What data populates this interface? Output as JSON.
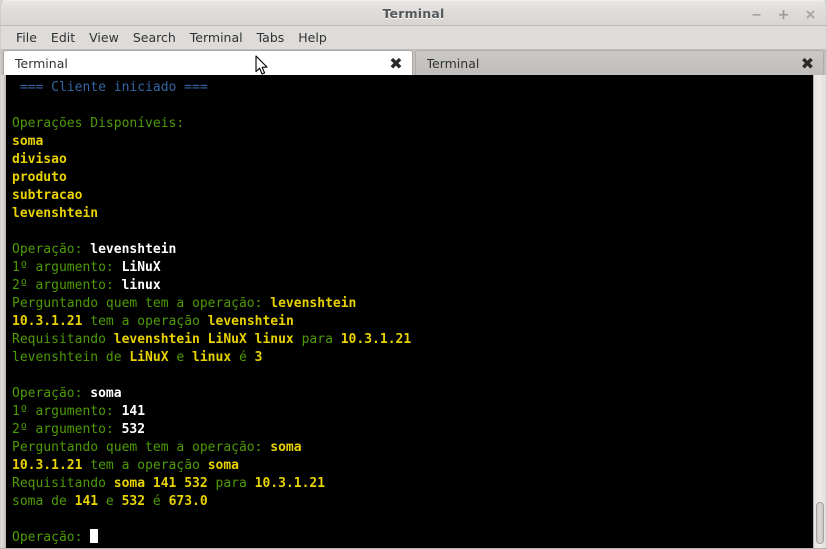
{
  "window": {
    "title": "Terminal",
    "controls": [
      {
        "name": "minimize-button",
        "glyph": "minimize"
      },
      {
        "name": "maximize-button",
        "glyph": "maximize"
      },
      {
        "name": "close-button",
        "glyph": "close"
      }
    ]
  },
  "menubar": {
    "items": [
      {
        "label": "File"
      },
      {
        "label": "Edit"
      },
      {
        "label": "View"
      },
      {
        "label": "Search"
      },
      {
        "label": "Terminal"
      },
      {
        "label": "Tabs"
      },
      {
        "label": "Help"
      }
    ]
  },
  "tabs": [
    {
      "label": "Terminal",
      "active": true,
      "close_glyph": "✖"
    },
    {
      "label": "Terminal",
      "active": false,
      "close_glyph": "✖"
    }
  ],
  "terminal": {
    "colors": {
      "background": "#000000",
      "green": "#4e9a06",
      "yellow_bold": "#e8d200",
      "white_bold": "#ffffff",
      "blue": "#3465a4"
    },
    "lines": [
      {
        "segments": [
          {
            "text": " === Cliente iniciado ===",
            "style": "blue"
          }
        ]
      },
      {
        "segments": []
      },
      {
        "segments": [
          {
            "text": "Operações Disponíveis:",
            "style": "green"
          }
        ]
      },
      {
        "segments": [
          {
            "text": "soma",
            "style": "ybold"
          }
        ]
      },
      {
        "segments": [
          {
            "text": "divisao",
            "style": "ybold"
          }
        ]
      },
      {
        "segments": [
          {
            "text": "produto",
            "style": "ybold"
          }
        ]
      },
      {
        "segments": [
          {
            "text": "subtracao",
            "style": "ybold"
          }
        ]
      },
      {
        "segments": [
          {
            "text": "levenshtein",
            "style": "ybold"
          }
        ]
      },
      {
        "segments": []
      },
      {
        "segments": [
          {
            "text": "Operação: ",
            "style": "green"
          },
          {
            "text": "levenshtein",
            "style": "white"
          }
        ]
      },
      {
        "segments": [
          {
            "text": "1º argumento: ",
            "style": "green"
          },
          {
            "text": "LiNuX",
            "style": "white"
          }
        ]
      },
      {
        "segments": [
          {
            "text": "2º argumento: ",
            "style": "green"
          },
          {
            "text": "linux",
            "style": "white"
          }
        ]
      },
      {
        "segments": [
          {
            "text": "Perguntando quem tem a operação: ",
            "style": "green"
          },
          {
            "text": "levenshtein",
            "style": "ybold"
          }
        ]
      },
      {
        "segments": [
          {
            "text": "10.3.1.21",
            "style": "ybold"
          },
          {
            "text": " tem a operação ",
            "style": "green"
          },
          {
            "text": "levenshtein",
            "style": "ybold"
          }
        ]
      },
      {
        "segments": [
          {
            "text": "Requisitando ",
            "style": "green"
          },
          {
            "text": "levenshtein LiNuX linux",
            "style": "ybold"
          },
          {
            "text": " para ",
            "style": "green"
          },
          {
            "text": "10.3.1.21",
            "style": "ybold"
          }
        ]
      },
      {
        "segments": [
          {
            "text": "levenshtein de ",
            "style": "green"
          },
          {
            "text": "LiNuX",
            "style": "ybold"
          },
          {
            "text": " e ",
            "style": "green"
          },
          {
            "text": "linux",
            "style": "ybold"
          },
          {
            "text": " é ",
            "style": "green"
          },
          {
            "text": "3",
            "style": "ybold"
          }
        ]
      },
      {
        "segments": []
      },
      {
        "segments": [
          {
            "text": "Operação: ",
            "style": "green"
          },
          {
            "text": "soma",
            "style": "white"
          }
        ]
      },
      {
        "segments": [
          {
            "text": "1º argumento: ",
            "style": "green"
          },
          {
            "text": "141",
            "style": "white"
          }
        ]
      },
      {
        "segments": [
          {
            "text": "2º argumento: ",
            "style": "green"
          },
          {
            "text": "532",
            "style": "white"
          }
        ]
      },
      {
        "segments": [
          {
            "text": "Perguntando quem tem a operação: ",
            "style": "green"
          },
          {
            "text": "soma",
            "style": "ybold"
          }
        ]
      },
      {
        "segments": [
          {
            "text": "10.3.1.21",
            "style": "ybold"
          },
          {
            "text": " tem a operação ",
            "style": "green"
          },
          {
            "text": "soma",
            "style": "ybold"
          }
        ]
      },
      {
        "segments": [
          {
            "text": "Requisitando ",
            "style": "green"
          },
          {
            "text": "soma 141 532",
            "style": "ybold"
          },
          {
            "text": " para ",
            "style": "green"
          },
          {
            "text": "10.3.1.21",
            "style": "ybold"
          }
        ]
      },
      {
        "segments": [
          {
            "text": "soma de ",
            "style": "green"
          },
          {
            "text": "141",
            "style": "ybold"
          },
          {
            "text": " e ",
            "style": "green"
          },
          {
            "text": "532",
            "style": "ybold"
          },
          {
            "text": " é ",
            "style": "green"
          },
          {
            "text": "673.0",
            "style": "ybold"
          }
        ]
      },
      {
        "segments": []
      },
      {
        "segments": [
          {
            "text": "Operação: ",
            "style": "green"
          }
        ],
        "cursor": true
      }
    ]
  }
}
